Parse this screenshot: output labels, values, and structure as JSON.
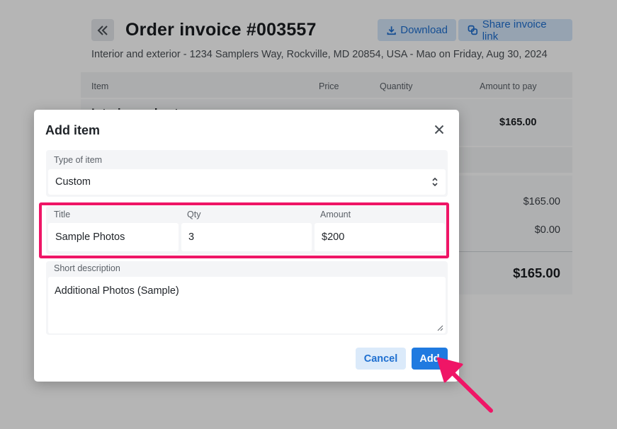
{
  "page": {
    "title": "Order invoice #003557",
    "subtitle": "Interior and exterior - 1234 Samplers Way, Rockville, MD 20854, USA - Mao on Friday, Aug 30, 2024",
    "download_label": "Download",
    "share_label": "Share invoice link",
    "table": {
      "headers": [
        "Item",
        "Price",
        "Quantity",
        "Amount to pay"
      ],
      "row_name_partial": "Interior and ext",
      "row_amount": "$165.00"
    },
    "summary": {
      "subtotal": "$165.00",
      "discount": "$0.00",
      "total": "$165.00"
    }
  },
  "modal": {
    "title": "Add item",
    "type_label": "Type of item",
    "type_value": "Custom",
    "title_label": "Title",
    "title_value": "Sample Photos",
    "qty_label": "Qty",
    "qty_value": "3",
    "amount_label": "Amount",
    "amount_value": "$200",
    "description_label": "Short description",
    "description_value": "Additional Photos (Sample)",
    "cancel_label": "Cancel",
    "add_label": "Add"
  },
  "colors": {
    "accent": "#1f7ae0",
    "highlight": "#ef1566"
  },
  "icons": [
    "double-chevron-left-icon",
    "download-icon",
    "link-icon",
    "close-icon",
    "select-arrows-icon",
    "resize-grip-icon",
    "pointer-arrow"
  ]
}
